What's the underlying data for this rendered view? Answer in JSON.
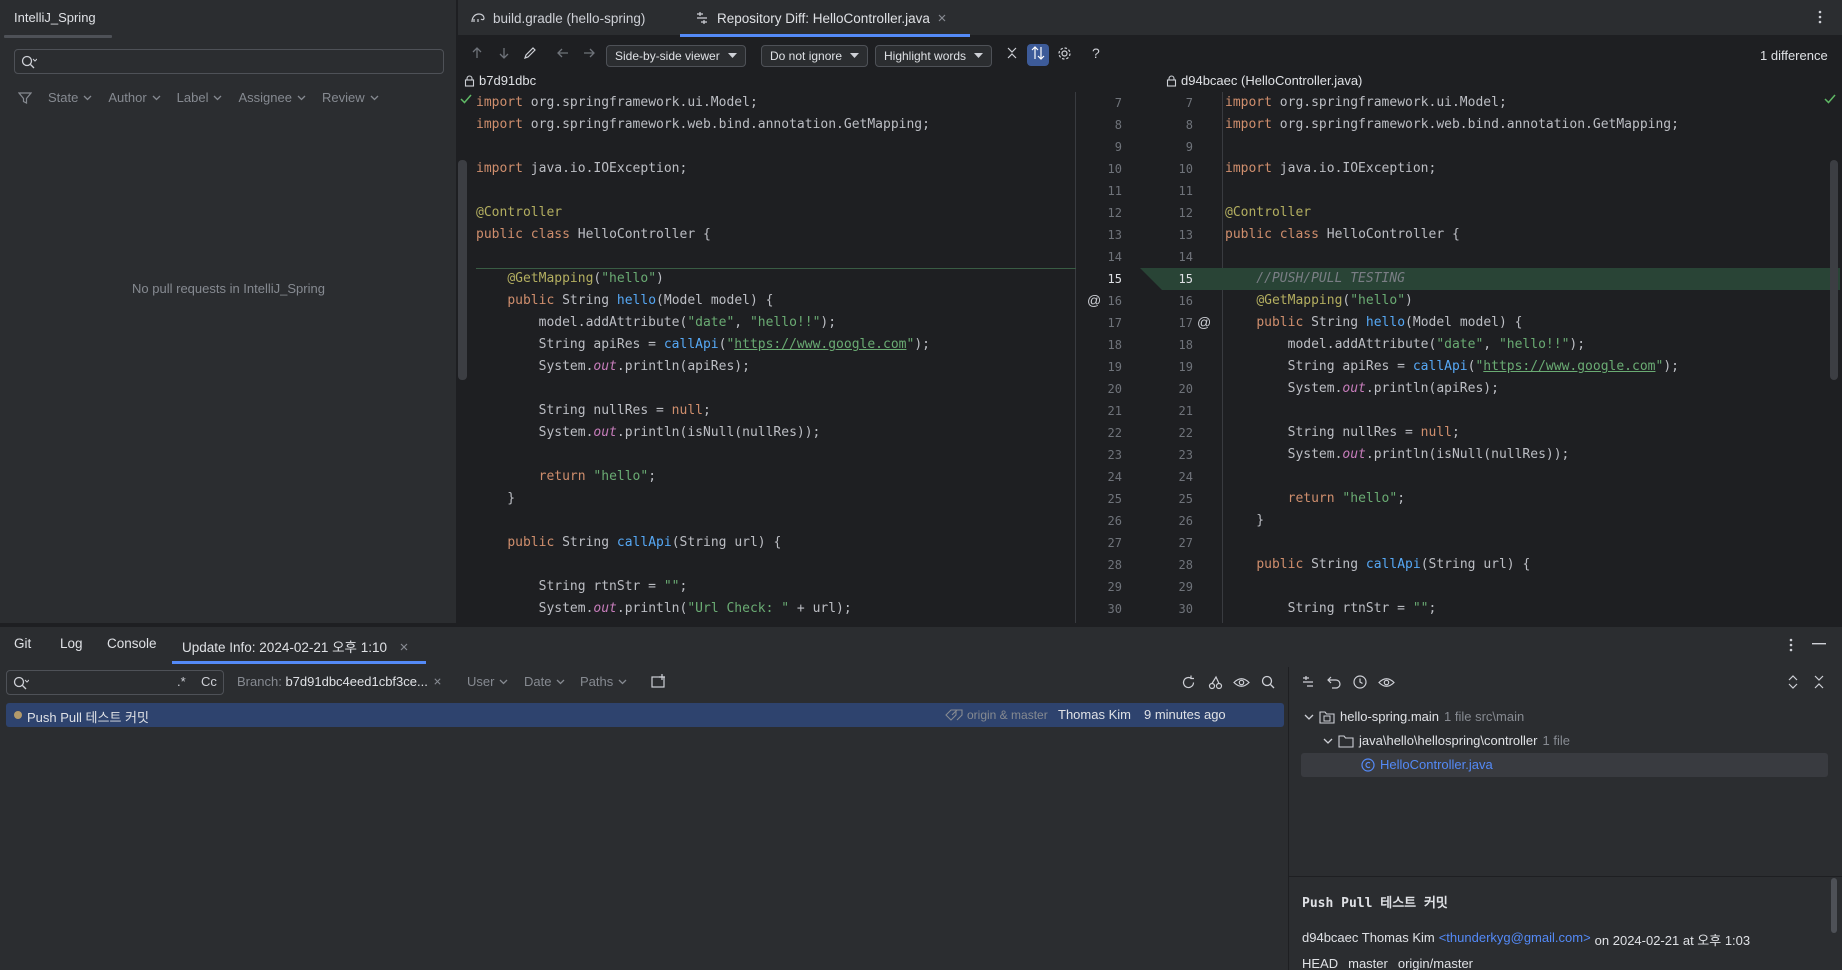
{
  "left_panel": {
    "tab": "IntelliJ_Spring",
    "search_placeholder": "",
    "filters": [
      "State",
      "Author",
      "Label",
      "Assignee",
      "Review"
    ],
    "empty_message": "No pull requests in IntelliJ_Spring"
  },
  "editor": {
    "tabs": [
      {
        "label": "build.gradle (hello-spring)"
      },
      {
        "label": "Repository Diff: HelloController.java"
      }
    ],
    "toolbar": {
      "viewer": "Side-by-side viewer",
      "ignore": "Do not ignore",
      "highlight": "Highlight words",
      "help": "?",
      "difference_count": "1 difference"
    },
    "left_header": "b7d91dbc",
    "right_header": "d94bcaec (HelloController.java)",
    "left_line_numbers": [
      "7",
      "8",
      "9",
      "10",
      "11",
      "12",
      "13",
      "14",
      "15",
      "16",
      "17",
      "18",
      "19",
      "20",
      "21",
      "22",
      "23",
      "24",
      "25",
      "26",
      "27",
      "28",
      "29",
      "30"
    ],
    "right_line_numbers": [
      "7",
      "8",
      "9",
      "10",
      "11",
      "12",
      "13",
      "14",
      "15",
      "16",
      "17",
      "18",
      "19",
      "20",
      "21",
      "22",
      "23",
      "24",
      "25",
      "26",
      "27",
      "28",
      "29",
      "30"
    ],
    "left_code": [
      "import org.springframework.ui.Model;",
      "import org.springframework.web.bind.annotation.GetMapping;",
      "",
      "import java.io.IOException;",
      "",
      "@Controller",
      "public class HelloController {",
      "",
      "    @GetMapping(\"hello\")",
      "    public String hello(Model model) {",
      "        model.addAttribute(\"date\", \"hello!!\");",
      "        String apiRes = callApi(\"https://www.google.com\");",
      "        System.out.println(apiRes);",
      "",
      "        String nullRes = null;",
      "        System.out.println(isNull(nullRes));",
      "",
      "        return \"hello\";",
      "    }",
      "",
      "    public String callApi(String url) {",
      "",
      "        String rtnStr = \"\";",
      "        System.out.println(\"Url Check: \" + url);"
    ],
    "right_code": [
      "import org.springframework.ui.Model;",
      "import org.springframework.web.bind.annotation.GetMapping;",
      "",
      "import java.io.IOException;",
      "",
      "@Controller",
      "public class HelloController {",
      "",
      "    //PUSH/PULL TESTING",
      "    @GetMapping(\"hello\")",
      "    public String hello(Model model) {",
      "        model.addAttribute(\"date\", \"hello!!\");",
      "        String apiRes = callApi(\"https://www.google.com\");",
      "        System.out.println(apiRes);",
      "",
      "        String nullRes = null;",
      "        System.out.println(isNull(nullRes));",
      "",
      "        return \"hello\";",
      "    }",
      "",
      "    public String callApi(String url) {",
      "",
      "        String rtnStr = \"\";"
    ],
    "current_line": "15"
  },
  "bottom": {
    "tabs": [
      "Git",
      "Log",
      "Console",
      "Update Info: 2024-02-21 오후 1:10"
    ],
    "search_placeholder": "",
    "regex_label": ".*",
    "case_label": "Cc",
    "branch_filter": "Branch: b7d91dbc4eed1cbf3ce...",
    "filters": [
      "User",
      "Date",
      "Paths"
    ],
    "commit": {
      "message": "Push Pull 테스트 커밋",
      "refs": "origin & master",
      "author": "Thomas Kim",
      "time": "9 minutes ago"
    },
    "tree": {
      "module": "hello-spring.main",
      "module_info": "1 file  src\\main",
      "package": "java\\hello\\hellospring\\controller",
      "package_info": "1 file",
      "file": "HelloController.java"
    },
    "details": {
      "title": "Push Pull 테스트 커밋",
      "hash_author": "d94bcaec Thomas Kim",
      "email": "<thunderkyg@gmail.com>",
      "date": "on 2024-02-21 at 오후 1:03",
      "refs": [
        "HEAD",
        "master",
        "origin/master"
      ]
    }
  },
  "colors": {
    "accent": "#548af7",
    "selection": "#2e436e",
    "inserted": "#294436",
    "keyword": "#cf8e6d",
    "annotation": "#b3ae60",
    "string": "#6aab73",
    "function": "#56a8f5"
  }
}
